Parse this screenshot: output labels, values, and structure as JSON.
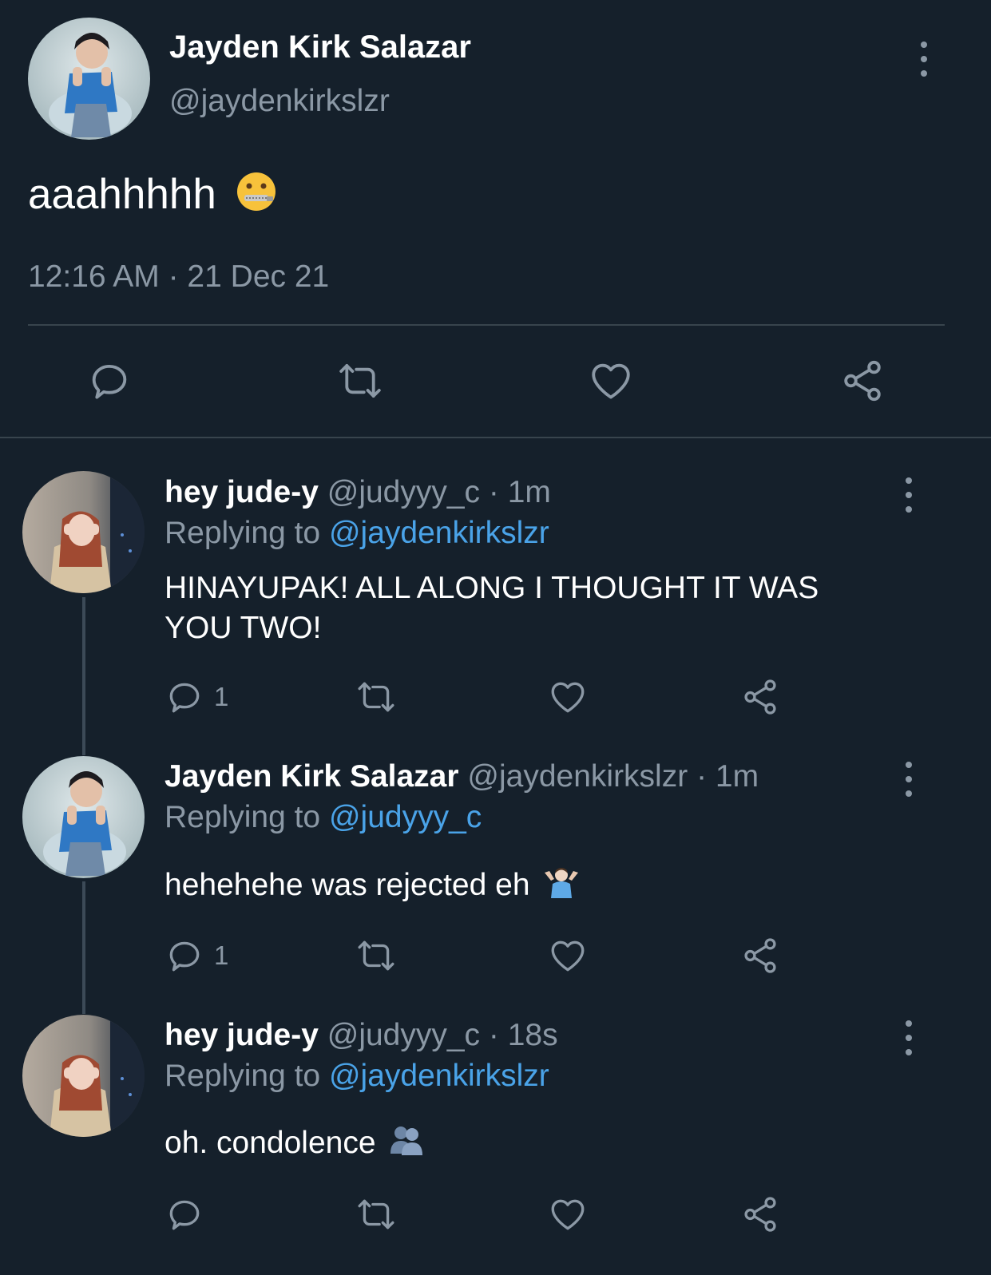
{
  "main_tweet": {
    "author_name": "Jayden Kirk Salazar",
    "author_handle": "@jaydenkirkslzr",
    "text": "aaahhhhh",
    "emoji": "zipper-mouth-face",
    "timestamp": "12:16 AM · 21 Dec 21"
  },
  "replies": [
    {
      "author_name": "hey jude-y",
      "author_handle": "@judyyy_c",
      "meta": "· 1m",
      "replying_prefix": "Replying to",
      "replying_to": "@jaydenkirkslzr",
      "text": "HINAYUPAK! ALL ALONG I THOUGHT IT WAS YOU TWO!",
      "reply_count": "1"
    },
    {
      "author_name": "Jayden Kirk Salazar",
      "author_handle": "@jaydenkirkslzr",
      "meta": "· 1m",
      "replying_prefix": "Replying to",
      "replying_to": "@judyyy_c",
      "text": "hehehehe was rejected eh",
      "emoji": "person-shrugging",
      "reply_count": "1"
    },
    {
      "author_name": "hey jude-y",
      "author_handle": "@judyyy_c",
      "meta": "· 18s",
      "replying_prefix": "Replying to",
      "replying_to": "@jaydenkirkslzr",
      "text": "oh. condolence",
      "emoji": "busts-in-silhouette",
      "reply_count": ""
    }
  ],
  "colors": {
    "background": "#15202b",
    "text_secondary": "#8b98a5",
    "link": "#4aa3e8",
    "divider": "#38444d"
  }
}
